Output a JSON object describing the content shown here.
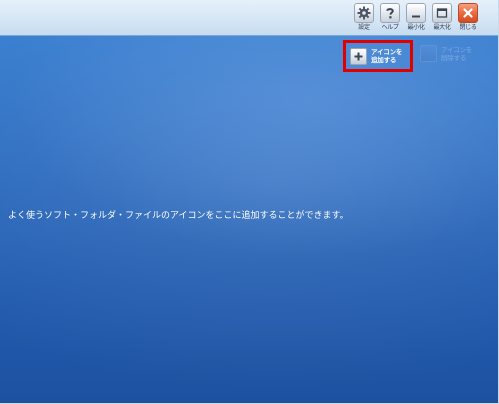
{
  "toolbar": {
    "buttons": [
      {
        "label": "設定",
        "icon": "gear-icon"
      },
      {
        "label": "ヘルプ",
        "icon": "help-icon"
      },
      {
        "label": "最小化",
        "icon": "minimize-icon"
      },
      {
        "label": "最大化",
        "icon": "maximize-icon"
      },
      {
        "label": "閉じる",
        "icon": "close-icon"
      }
    ]
  },
  "desktop": {
    "add_icon_label": "アイコンを\n追加する",
    "delete_icon_label": "アイコンを\n削除する",
    "message": "よく使うソフト・フォルダ・ファイルのアイコンをここに追加することができます。"
  },
  "colors": {
    "desktop_blue": "#2f6fc2",
    "highlight_red": "#e00000",
    "close_orange": "#ea6b40"
  }
}
